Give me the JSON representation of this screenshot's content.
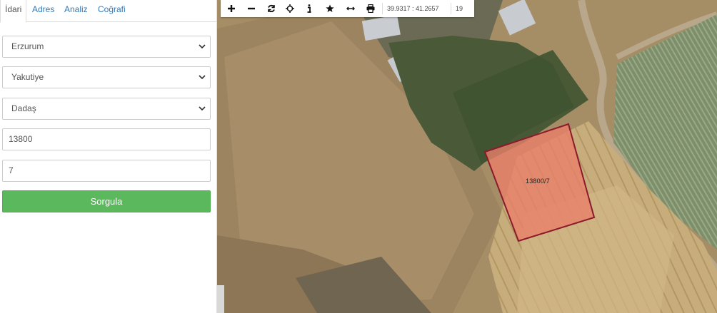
{
  "tabs": [
    "İdari",
    "Adres",
    "Analiz",
    "Coğrafi"
  ],
  "form": {
    "province": "Erzurum",
    "district": "Yakutiye",
    "neighborhood": "Dadaş",
    "block": "13800",
    "parcel": "7",
    "submit_label": "Sorgula"
  },
  "map": {
    "coordinates": "39.9317 : 41.2657",
    "zoom_level": "19",
    "parcel_label": "13800/7",
    "parcel_color": "#8b1a2b",
    "parcel_fill": "#e8806a"
  },
  "icons": [
    "plus-icon",
    "minus-icon",
    "refresh-icon",
    "crosshair-icon",
    "info-icon",
    "star-icon",
    "measure-icon",
    "print-icon",
    "chevron-down-icon"
  ]
}
